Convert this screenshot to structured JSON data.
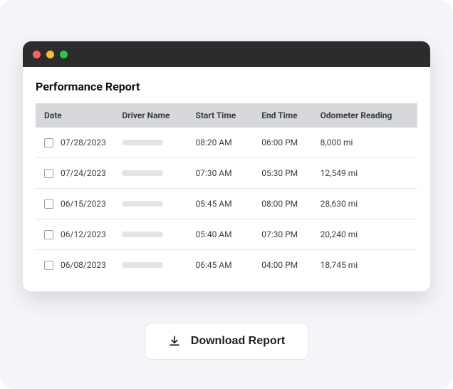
{
  "report": {
    "title": "Performance Report",
    "columns": {
      "date": "Date",
      "driver": "Driver Name",
      "start": "Start Time",
      "end": "End Time",
      "odometer": "Odometer Reading"
    },
    "rows": [
      {
        "date": "07/28/2023",
        "start": "08:20 AM",
        "end": "06:00 PM",
        "odometer": "8,000 mi"
      },
      {
        "date": "07/24/2023",
        "start": "07:30 AM",
        "end": "05:30 PM",
        "odometer": "12,549 mi"
      },
      {
        "date": "06/15/2023",
        "start": "05:45 AM",
        "end": "08:00 PM",
        "odometer": "28,630 mi"
      },
      {
        "date": "06/12/2023",
        "start": "05:40 AM",
        "end": "07:30 PM",
        "odometer": "20,240 mi"
      },
      {
        "date": "06/08/2023",
        "start": "06:45 AM",
        "end": "04:00 PM",
        "odometer": "18,745 mi"
      }
    ]
  },
  "actions": {
    "download_label": "Download Report"
  }
}
